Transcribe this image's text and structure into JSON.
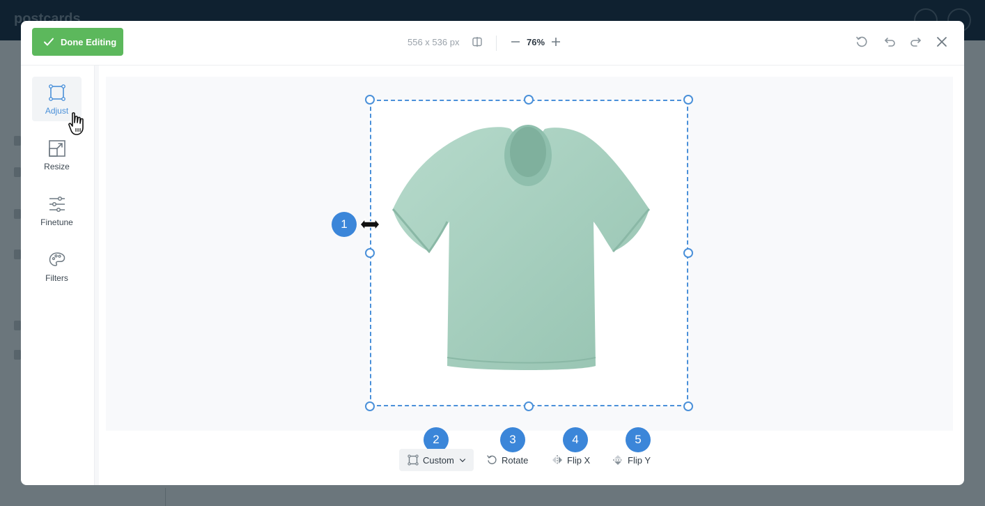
{
  "background": {
    "logo_text": "postcards"
  },
  "header": {
    "done_label": "Done Editing",
    "dimensions": "556 x 536 px",
    "zoom": "76%"
  },
  "tools": [
    {
      "label": "Adjust",
      "icon": "crop-frame-icon",
      "active": true
    },
    {
      "label": "Resize",
      "icon": "resize-icon",
      "active": false
    },
    {
      "label": "Finetune",
      "icon": "sliders-icon",
      "active": false
    },
    {
      "label": "Filters",
      "icon": "palette-icon",
      "active": false
    }
  ],
  "badges": [
    "1",
    "2",
    "3",
    "4",
    "5"
  ],
  "controls": {
    "custom_label": "Custom",
    "rotate_label": "Rotate",
    "flipx_label": "Flip X",
    "flipy_label": "Flip Y"
  },
  "colors": {
    "accent": "#4a90d9",
    "done_button": "#5cb85c",
    "badge": "#3b86d9",
    "tshirt": "#a8cfc0"
  }
}
